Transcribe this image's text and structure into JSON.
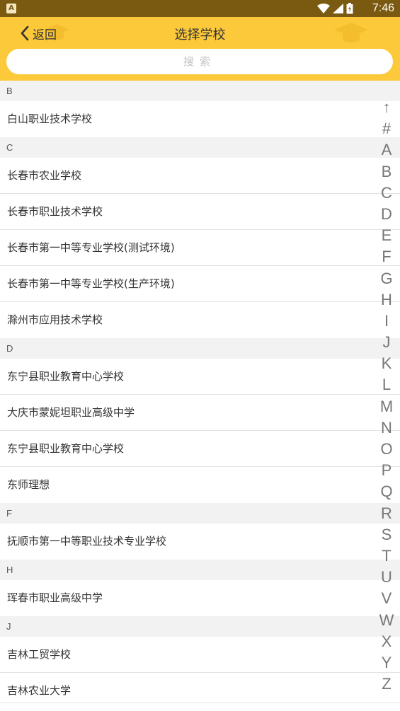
{
  "status_bar": {
    "app_badge": "A",
    "time": "7:46"
  },
  "header": {
    "back_label": "返回",
    "title": "选择学校",
    "search_placeholder": "搜索"
  },
  "sections": [
    {
      "letter": "B",
      "items": [
        "白山职业技术学校"
      ]
    },
    {
      "letter": "C",
      "items": [
        "长春市农业学校",
        "长春市职业技术学校",
        "长春市第一中等专业学校(测试环境)",
        "长春市第一中等专业学校(生产环境)",
        "滁州市应用技术学校"
      ]
    },
    {
      "letter": "D",
      "items": [
        "东宁县职业教育中心学校",
        "大庆市蒙妮坦职业高级中学",
        "东宁县职业教育中心学校",
        "东师理想"
      ]
    },
    {
      "letter": "F",
      "items": [
        "抚顺市第一中等职业技术专业学校"
      ]
    },
    {
      "letter": "H",
      "items": [
        "珲春市职业高级中学"
      ]
    },
    {
      "letter": "J",
      "items": [
        "吉林工贸学校",
        "吉林农业大学"
      ]
    }
  ],
  "index_bar": [
    "↑",
    "#",
    "A",
    "B",
    "C",
    "D",
    "E",
    "F",
    "G",
    "H",
    "I",
    "J",
    "K",
    "L",
    "M",
    "N",
    "O",
    "P",
    "Q",
    "R",
    "S",
    "T",
    "U",
    "V",
    "W",
    "X",
    "Y",
    "Z"
  ],
  "colors": {
    "header": "#fcc93a",
    "status_bar": "#7a5a10"
  }
}
